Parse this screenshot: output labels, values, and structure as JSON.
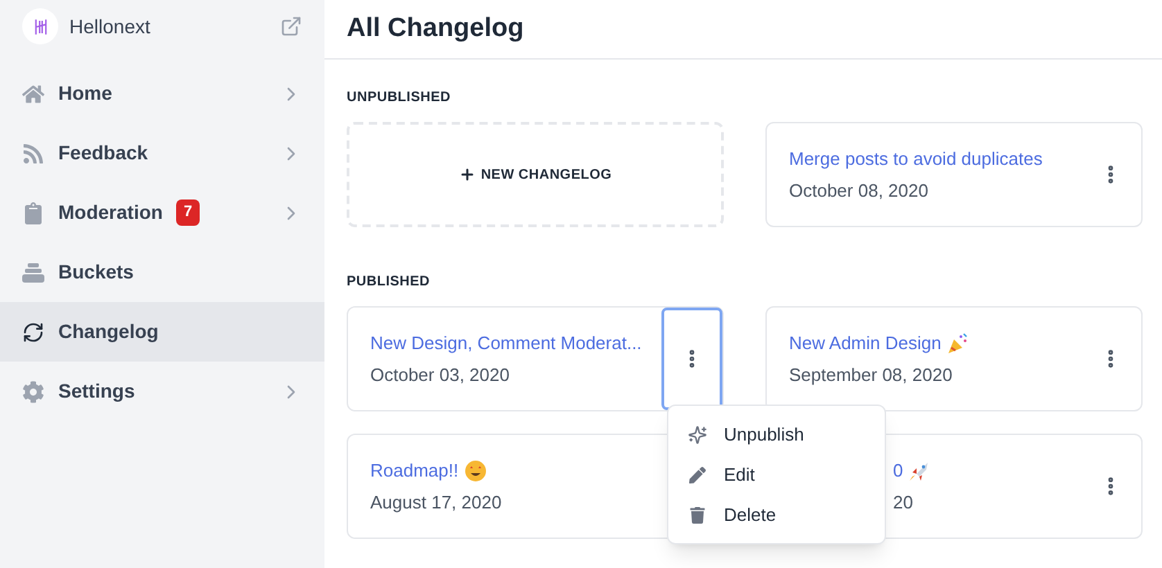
{
  "sidebar": {
    "brand": "Hellonext",
    "items": [
      {
        "label": "Home",
        "selected": false,
        "has_submenu": true
      },
      {
        "label": "Feedback",
        "selected": false,
        "has_submenu": true
      },
      {
        "label": "Moderation",
        "selected": false,
        "has_submenu": true,
        "badge": "7"
      },
      {
        "label": "Buckets",
        "selected": false,
        "has_submenu": false
      },
      {
        "label": "Changelog",
        "selected": true,
        "has_submenu": false
      },
      {
        "label": "Settings",
        "selected": false,
        "has_submenu": true
      }
    ]
  },
  "header": {
    "title": "All Changelog"
  },
  "sections": [
    {
      "heading": "UNPUBLISHED",
      "new_button": "NEW CHANGELOG",
      "posts": [
        {
          "title": "Merge posts to avoid duplicates",
          "date": "October 08, 2020",
          "menu_open": false,
          "partly_hidden": false
        }
      ]
    },
    {
      "heading": "PUBLISHED",
      "posts": [
        {
          "title": "New Design, Comment Moderat...",
          "date": "October 03, 2020",
          "menu_open": true,
          "partly_hidden": false
        },
        {
          "title": "New Admin Design",
          "date": "September 08, 2020",
          "menu_open": false,
          "partly_hidden": false
        },
        {
          "title": "Roadmap!!",
          "date": "August 17, 2020",
          "menu_open": false,
          "partly_hidden": false
        },
        {
          "title": "0",
          "date": "20",
          "menu_open": false,
          "partly_hidden": true
        }
      ]
    }
  ],
  "menu": {
    "items": [
      "Unpublish",
      "Edit",
      "Delete"
    ]
  }
}
